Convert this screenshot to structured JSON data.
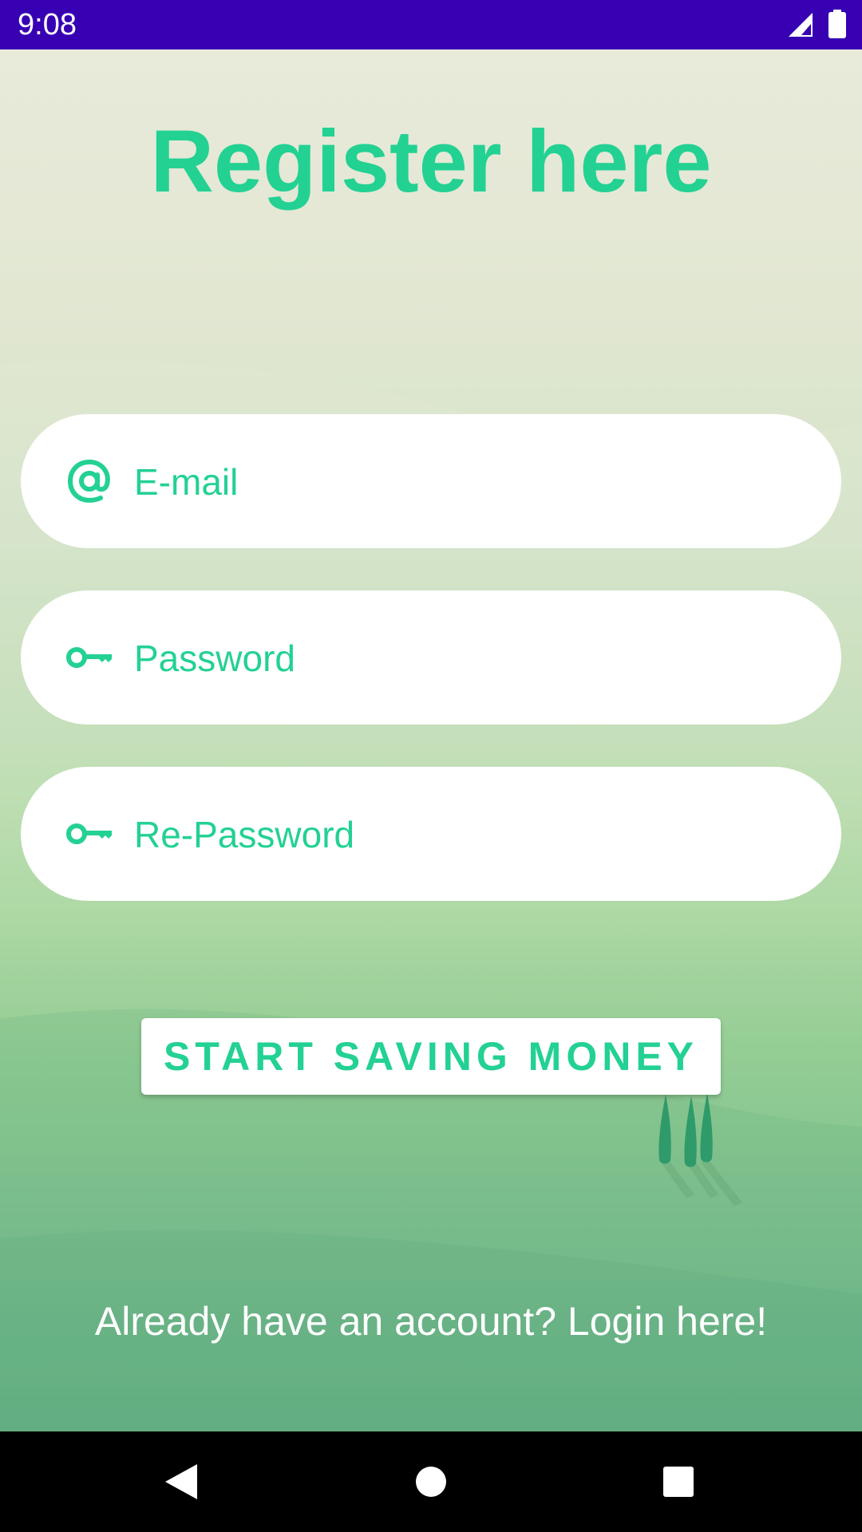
{
  "status_bar": {
    "time": "9:08",
    "signal_icon": "signal-icon",
    "battery_icon": "battery-icon",
    "background_color": "#3700b3"
  },
  "title": "Register here",
  "form": {
    "email": {
      "placeholder": "E-mail",
      "value": "",
      "icon": "at-sign-icon"
    },
    "password": {
      "placeholder": "Password",
      "value": "",
      "icon": "key-icon"
    },
    "repassword": {
      "placeholder": "Re-Password",
      "value": "",
      "icon": "key-icon"
    }
  },
  "start_button_label": "START SAVING MONEY",
  "login_link": "Already have an account? Login here!",
  "nav_bar": {
    "back_icon": "back-triangle-icon",
    "home_icon": "home-circle-icon",
    "recents_icon": "recents-square-icon"
  },
  "colors": {
    "accent": "#23d193",
    "field_background": "#ffffff",
    "status_bar": "#3700b3",
    "nav_bar": "#000000"
  }
}
